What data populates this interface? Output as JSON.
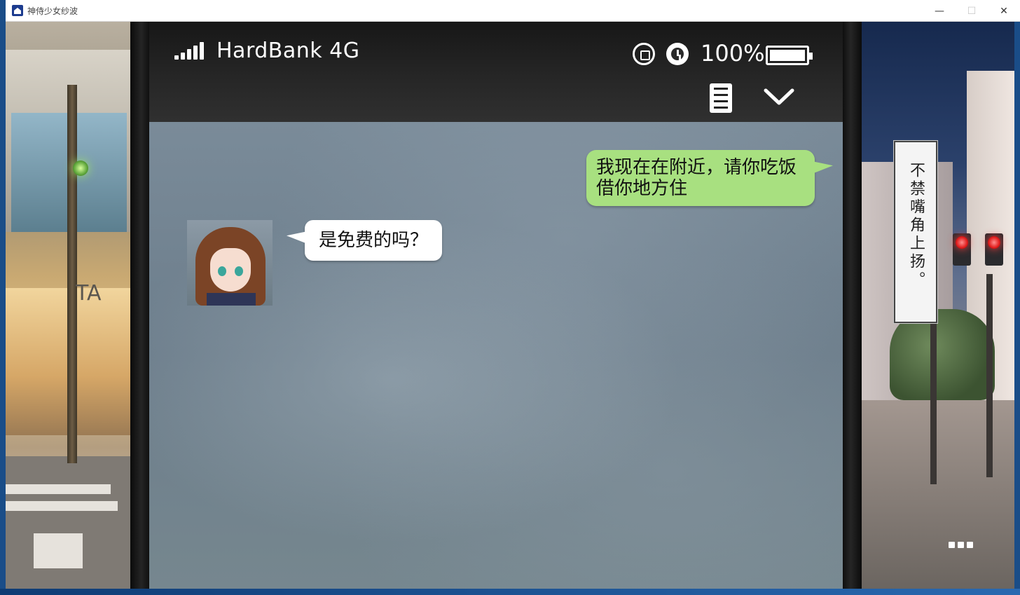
{
  "window": {
    "title": "神侍少女纱波",
    "controls": {
      "minimize": "—",
      "maximize": "☐",
      "close": "✕"
    }
  },
  "phone": {
    "status_bar": {
      "signal_bars": 5,
      "carrier": "HardBank 4G",
      "battery_percent": "100%",
      "battery_level": 1.0,
      "icons": [
        "rotation-lock-icon",
        "alarm-clock-icon",
        "battery-icon"
      ]
    },
    "toolbar": {
      "icons": [
        "message-log-icon",
        "chevron-down-icon"
      ]
    },
    "chat": {
      "messages": [
        {
          "side": "right",
          "text_line1": "我现在在附近，请你吃饭",
          "text_line2": "借你地方住"
        },
        {
          "side": "left",
          "avatar": "girl-avatar",
          "text": "是免费的吗？"
        }
      ]
    }
  },
  "scene": {
    "caption": "不禁嘴角上扬。",
    "menu_icon": "more-dots-icon",
    "sign_text": "TA"
  },
  "colors": {
    "right_bubble": "#a8e080",
    "left_bubble": "#ffffff",
    "status_bar": "#1f1f1f",
    "chat_background": "#72838f"
  }
}
